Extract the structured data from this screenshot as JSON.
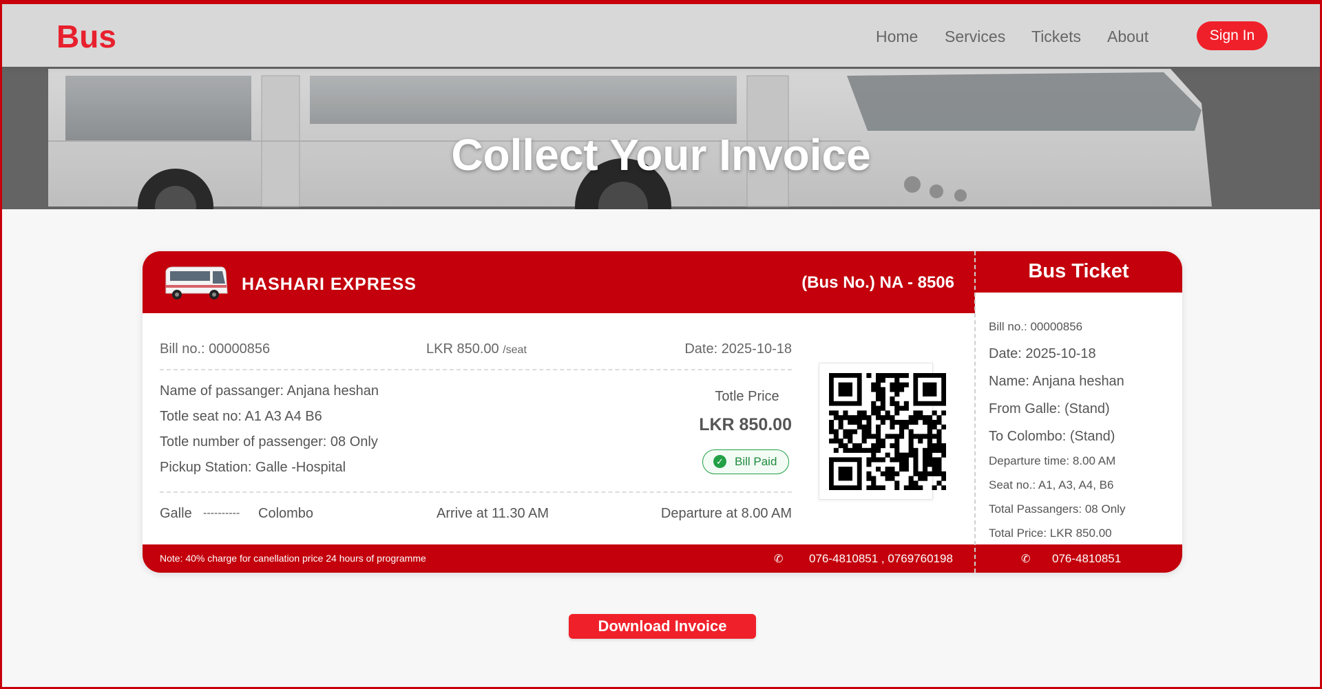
{
  "nav": {
    "brand": "Bus",
    "links": [
      "Home",
      "Services",
      "Tickets",
      "About"
    ],
    "signin_label": "Sign In"
  },
  "hero": {
    "title": "Collect Your Invoice"
  },
  "ticket": {
    "company": "HASHARI EXPRESS",
    "bus_no": "(Bus No.) NA - 8506",
    "bill_no": "Bill no.: 00000856",
    "seat_price": "LKR 850.00",
    "seat_unit": "/seat",
    "date": "Date: 2025-10-18",
    "passenger_name": "Name of passanger: Anjana heshan",
    "seat_no": "Totle seat no: A1 A3 A4 B6",
    "passenger_count": "Totle number of passenger: 08 Only",
    "pickup": "Pickup Station: Galle -Hospital",
    "total_label": "Totle Price",
    "total_value": "LKR 850.00",
    "paid_status": "Bill Paid",
    "from": "Galle",
    "route_sep": "----------",
    "to": "Colombo",
    "arrive": "Arrive at 11.30 AM",
    "departure": "Departure at 8.00 AM",
    "note": "Note: 40% charge for canellation price 24 hours of programme",
    "phones": "076-4810851 , 0769760198",
    "icons": {
      "bus": "bus-icon",
      "check": "check-circle-icon",
      "phone": "phone-icon",
      "qr": "qr-code"
    }
  },
  "stub": {
    "title": "Bus Ticket",
    "lines": [
      "Bill no.: 00000856",
      "Date: 2025-10-18",
      "Name: Anjana heshan",
      "From Galle: (Stand)",
      "To Colombo: (Stand)",
      "Departure time: 8.00 AM",
      "Seat no.: A1, A3, A4, B6",
      "Total Passangers: 08 Only",
      "Total Price: LKR 850.00"
    ],
    "phone": "076-4810851"
  },
  "download_label": "Download Invoice",
  "colors": {
    "brand_red": "#e8202d",
    "ticket_red": "#c3000c",
    "button_red": "#f0202a",
    "paid_green": "#22a046"
  }
}
